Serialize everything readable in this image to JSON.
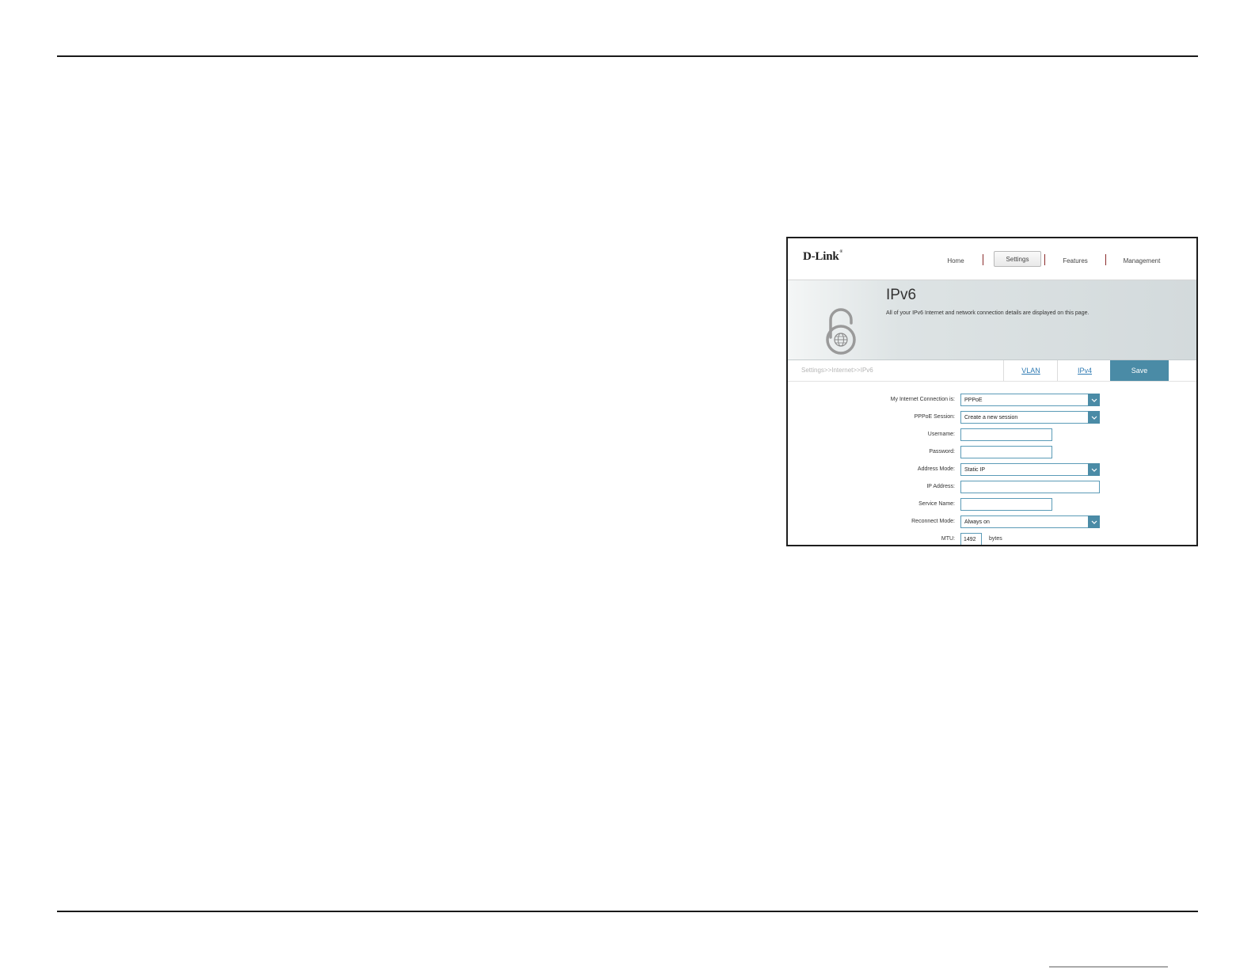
{
  "app": {
    "logo": "D-Link",
    "logo_mark": "®",
    "nav": [
      {
        "label": "Home"
      },
      {
        "label": "Settings"
      },
      {
        "label": "Features"
      },
      {
        "label": "Management"
      }
    ],
    "active_nav": "Settings"
  },
  "banner": {
    "title": "IPv6",
    "description": "All of your IPv6 Internet and network connection details are displayed on this page.",
    "icon": "lock-globe-icon"
  },
  "subnav": {
    "breadcrumb": "Settings>>Internet>>IPv6",
    "tabs": [
      {
        "label": "VLAN"
      },
      {
        "label": "IPv4"
      }
    ],
    "save_label": "Save"
  },
  "form": {
    "fields": [
      {
        "label": "My Internet Connection is:",
        "value": "PPPoE",
        "type": "select"
      },
      {
        "label": "PPPoE Session:",
        "value": "Create a new session",
        "type": "select"
      },
      {
        "label": "Username:",
        "value": "",
        "type": "text"
      },
      {
        "label": "Password:",
        "value": "",
        "type": "password"
      },
      {
        "label": "Address Mode:",
        "value": "Static IP",
        "type": "select"
      },
      {
        "label": "IP Address:",
        "value": "",
        "type": "text"
      },
      {
        "label": "Service Name:",
        "value": "",
        "type": "text"
      },
      {
        "label": "Reconnect Mode:",
        "value": "Always on",
        "type": "select"
      },
      {
        "label": "MTU:",
        "value": "1492",
        "type": "number",
        "unit": "bytes"
      }
    ]
  },
  "colors": {
    "accent": "#4a8ba6",
    "link": "#2e7ab3",
    "field_border": "#5b9bb7",
    "nav_separator": "#8a2a2a"
  }
}
